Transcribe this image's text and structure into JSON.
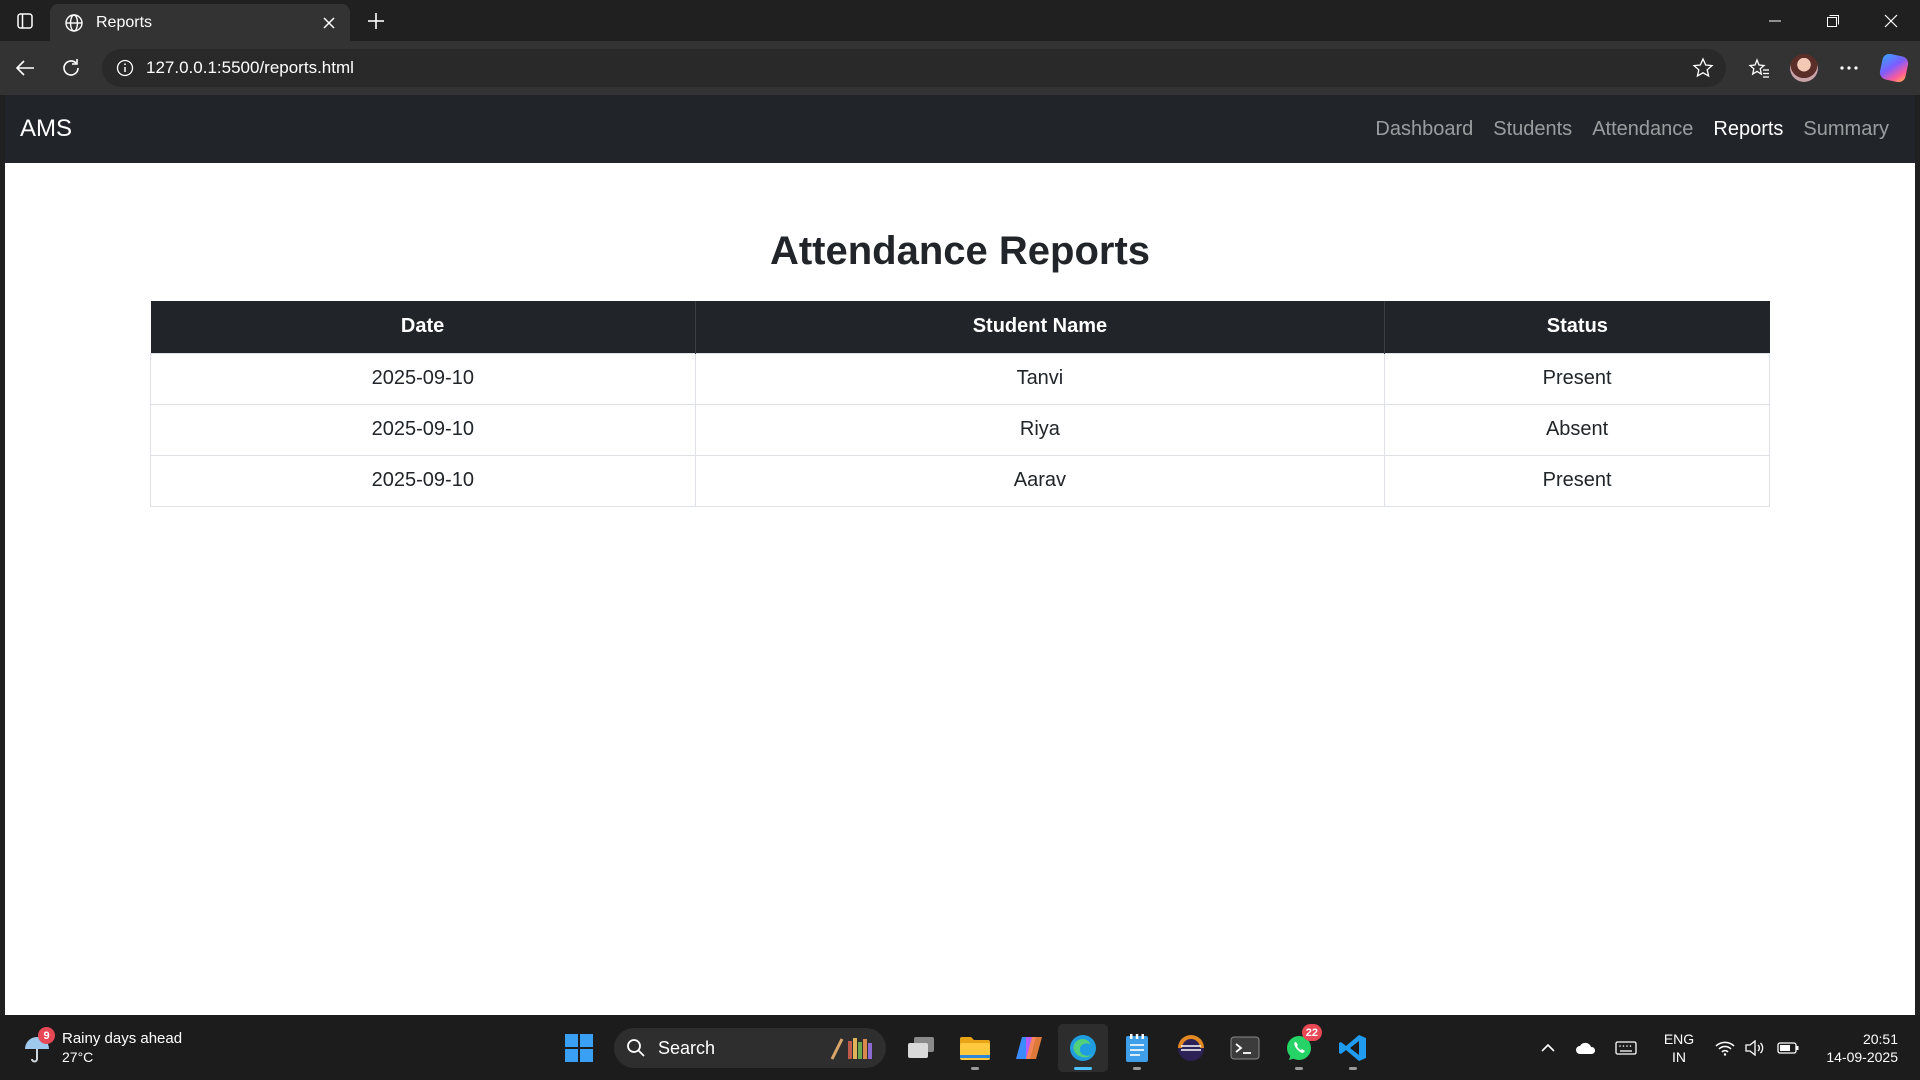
{
  "browser": {
    "tab_title": "Reports",
    "url": "127.0.0.1:5500/reports.html"
  },
  "navbar": {
    "brand": "AMS",
    "links": [
      {
        "label": "Dashboard",
        "active": false
      },
      {
        "label": "Students",
        "active": false
      },
      {
        "label": "Attendance",
        "active": false
      },
      {
        "label": "Reports",
        "active": true
      },
      {
        "label": "Summary",
        "active": false
      }
    ]
  },
  "page": {
    "title": "Attendance Reports"
  },
  "table": {
    "headers": [
      "Date",
      "Student Name",
      "Status"
    ],
    "rows": [
      [
        "2025-09-10",
        "Tanvi",
        "Present"
      ],
      [
        "2025-09-10",
        "Riya",
        "Absent"
      ],
      [
        "2025-09-10",
        "Aarav",
        "Present"
      ]
    ]
  },
  "taskbar": {
    "weather_badge": "9",
    "weather_title": "Rainy days ahead",
    "weather_temp": "27°C",
    "search_label": "Search",
    "whatsapp_badge": "22",
    "lang_line1": "ENG",
    "lang_line2": "IN",
    "time": "20:51",
    "date": "14-09-2025"
  },
  "colors": {
    "navbar_bg": "#212529",
    "table_header_bg": "#212529",
    "accent_edge": "#4cc2ff"
  }
}
